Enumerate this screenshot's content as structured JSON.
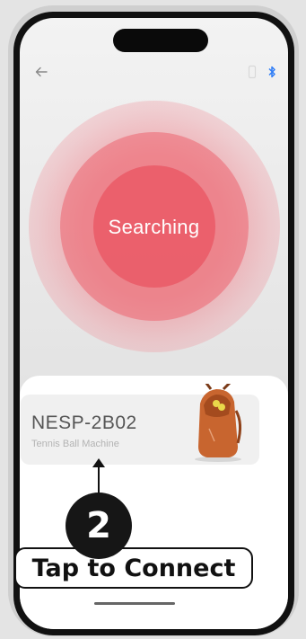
{
  "header": {
    "back_icon": "arrow-left-icon",
    "status_icons": [
      "phone-icon",
      "bluetooth-icon"
    ],
    "bluetooth_color": "#2f7df6"
  },
  "search": {
    "label": "Searching",
    "accent_color": "#ea5a66"
  },
  "device": {
    "name": "NESP-2B02",
    "type": "Tennis Ball Machine",
    "image_icon": "tennis-ball-machine-bag-image"
  },
  "callout": {
    "step_number": "2",
    "text": "Tap to Connect"
  }
}
